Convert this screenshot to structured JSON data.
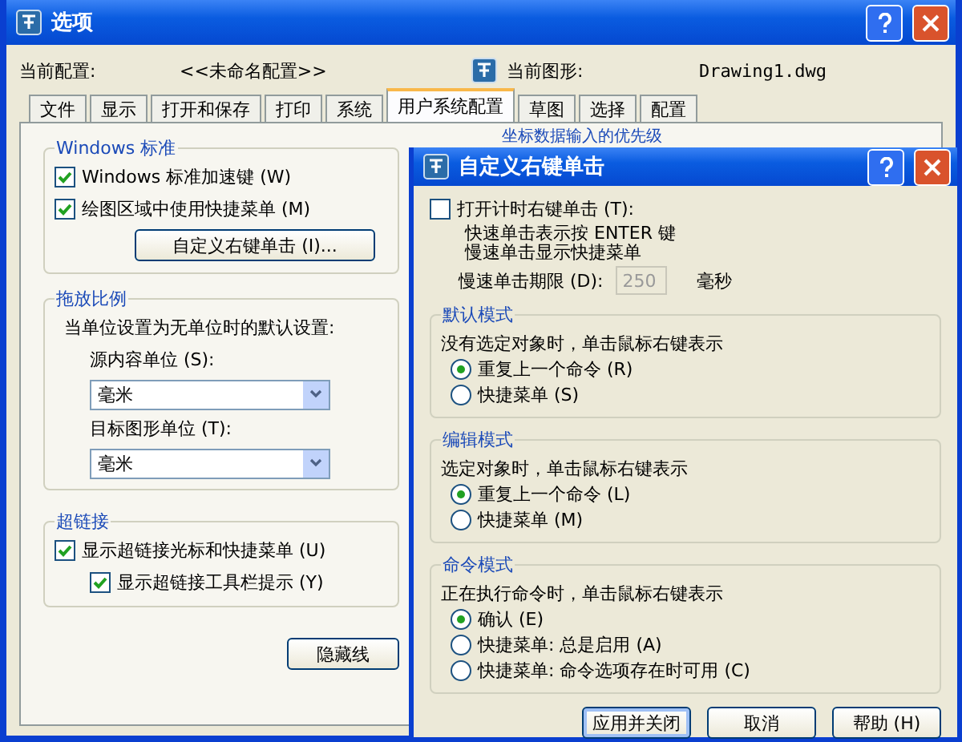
{
  "window": {
    "title": "选项"
  },
  "header": {
    "profile_label": "当前配置:",
    "profile_value": "<<未命名配置>>",
    "drawing_label": "当前图形:",
    "drawing_value": "Drawing1.dwg"
  },
  "tabs": [
    {
      "label": "文件",
      "selected": false
    },
    {
      "label": "显示",
      "selected": false
    },
    {
      "label": "打开和保存",
      "selected": false
    },
    {
      "label": "打印",
      "selected": false
    },
    {
      "label": "系统",
      "selected": false
    },
    {
      "label": "用户系统配置",
      "selected": true
    },
    {
      "label": "草图",
      "selected": false
    },
    {
      "label": "选择",
      "selected": false
    },
    {
      "label": "配置",
      "selected": false
    }
  ],
  "windows_group": {
    "title": "Windows 标准",
    "checkboxes": [
      {
        "label": "Windows 标准加速键 (W)",
        "checked": true
      },
      {
        "label": "绘图区域中使用快捷菜单 (M)",
        "checked": true
      }
    ],
    "button": "自定义右键单击 (I)..."
  },
  "scale_group": {
    "title": "拖放比例",
    "description": "当单位设置为无单位时的默认设置:",
    "fields": [
      {
        "label": "源内容单位 (S):",
        "value": "毫米"
      },
      {
        "label": "目标图形单位 (T):",
        "value": "毫米"
      }
    ]
  },
  "hyperlink_group": {
    "title": "超链接",
    "checkboxes": [
      {
        "label": "显示超链接光标和快捷菜单 (U)",
        "checked": true,
        "children": [
          {
            "label": "显示超链接工具栏提示 (Y)",
            "checked": true
          }
        ]
      }
    ]
  },
  "right_column": {
    "group_title": "坐标数据输入的优先级",
    "button": "隐藏线"
  },
  "dialog": {
    "title": "自定义右键单击",
    "timer_checkbox": {
      "label": "打开计时右键单击 (T):",
      "checked": false
    },
    "timer_notes": [
      "快速单击表示按 ENTER 键",
      "慢速单击显示快捷菜单"
    ],
    "delay": {
      "label": "慢速单击期限 (D):",
      "value": "250",
      "disabled": true,
      "unit": "毫秒"
    },
    "groups": [
      {
        "title": "默认模式",
        "description": "没有选定对象时，单击鼠标右键表示",
        "options": [
          {
            "label": "重复上一个命令 (R)",
            "selected": true
          },
          {
            "label": "快捷菜单 (S)",
            "selected": false
          }
        ]
      },
      {
        "title": "编辑模式",
        "description": "选定对象时，单击鼠标右键表示",
        "options": [
          {
            "label": "重复上一个命令 (L)",
            "selected": true
          },
          {
            "label": "快捷菜单 (M)",
            "selected": false
          }
        ]
      },
      {
        "title": "命令模式",
        "description": "正在执行命令时，单击鼠标右键表示",
        "options": [
          {
            "label": "确认 (E)",
            "selected": true
          },
          {
            "label": "快捷菜单: 总是启用 (A)",
            "selected": false
          },
          {
            "label": "快捷菜单: 命令选项存在时可用 (C)",
            "selected": false
          }
        ]
      }
    ],
    "buttons": [
      {
        "label": "应用并关闭",
        "default": true
      },
      {
        "label": "取消",
        "default": false
      },
      {
        "label": "帮助 (H)",
        "default": false
      }
    ]
  }
}
